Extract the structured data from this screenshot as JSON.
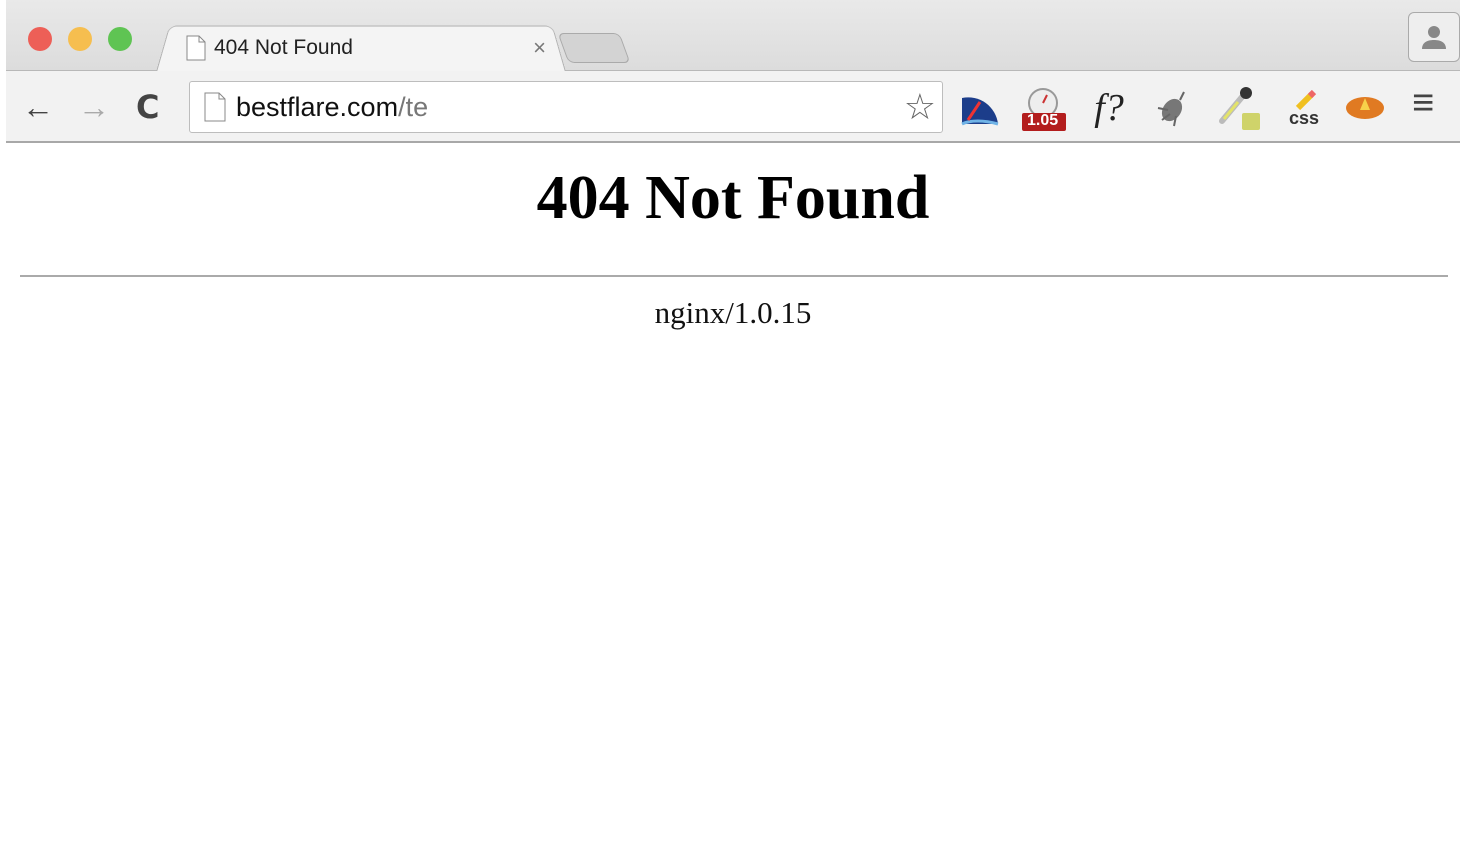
{
  "window": {
    "traffic_lights": {
      "close": "#ed5f57",
      "minimize": "#f6be4f",
      "zoom": "#5fc453"
    }
  },
  "tab": {
    "title": "404 Not Found",
    "close_label": "×",
    "icon": "page-icon"
  },
  "toolbar": {
    "back": "←",
    "forward": "→",
    "reload": "C",
    "url_host": "bestflare.com",
    "url_path": "/te",
    "extensions": [
      {
        "icon": "speedometer-icon"
      },
      {
        "icon": "stopwatch-icon",
        "badge": "1.05"
      },
      {
        "icon": "font-question-icon",
        "label": "f?"
      },
      {
        "icon": "bug-icon"
      },
      {
        "icon": "eyedropper-icon"
      },
      {
        "icon": "css-pencil-icon",
        "label": "css"
      },
      {
        "icon": "fire-bubble-icon"
      }
    ],
    "menu": "≡"
  },
  "page": {
    "heading": "404 Not Found",
    "server": "nginx/1.0.15"
  }
}
